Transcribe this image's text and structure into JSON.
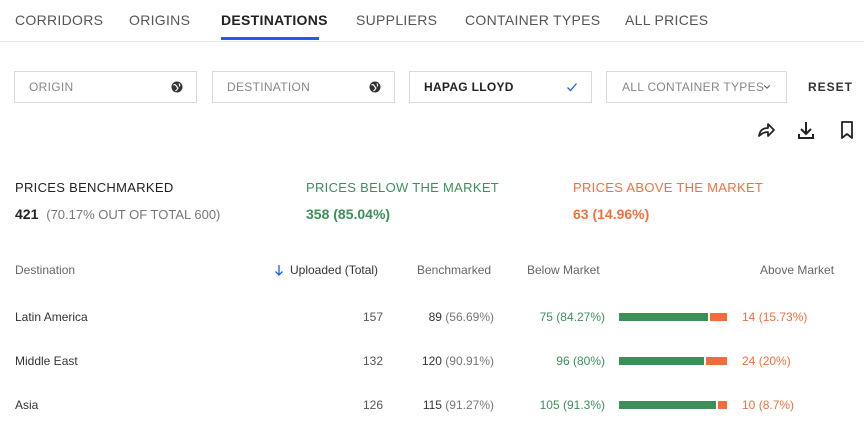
{
  "tabs": [
    "CORRIDORS",
    "ORIGINS",
    "DESTINATIONS",
    "SUPPLIERS",
    "CONTAINER TYPES",
    "ALL PRICES"
  ],
  "active_tab": "DESTINATIONS",
  "filters": {
    "origin_placeholder": "ORIGIN",
    "destination_placeholder": "DESTINATION",
    "supplier_value": "HAPAG LLOYD",
    "container_value": "ALL CONTAINER TYPES",
    "reset_label": "RESET"
  },
  "summary": {
    "benchmarked_label": "PRICES BENCHMARKED",
    "benchmarked_count": "421",
    "benchmarked_note": "(70.17% OUT OF TOTAL 600)",
    "below_label": "PRICES BELOW THE MARKET",
    "below_value": "358  (85.04%)",
    "above_label": "PRICES ABOVE THE MARKET",
    "above_value": "63  (14.96%)"
  },
  "table": {
    "headers": {
      "destination": "Destination",
      "uploaded": "Uploaded (Total)",
      "benchmarked": "Benchmarked",
      "below": "Below Market",
      "above": "Above Market"
    },
    "rows": [
      {
        "destination": "Latin America",
        "uploaded": "157",
        "benchmarked": "89",
        "benchmarked_pct": "(56.69%)",
        "below": "75",
        "below_pct": "(84.27%)",
        "above": "14",
        "above_pct": "(15.73%)",
        "below_fraction": 0.8427
      },
      {
        "destination": "Middle East",
        "uploaded": "132",
        "benchmarked": "120",
        "benchmarked_pct": "(90.91%)",
        "below": "96",
        "below_pct": "(80%)",
        "above": "24",
        "above_pct": "(20%)",
        "below_fraction": 0.8
      },
      {
        "destination": "Asia",
        "uploaded": "126",
        "benchmarked": "115",
        "benchmarked_pct": "(91.27%)",
        "below": "105",
        "below_pct": "(91.3%)",
        "above": "10",
        "above_pct": "(8.7%)",
        "below_fraction": 0.913
      }
    ]
  },
  "colors": {
    "accent": "#1e5ee6",
    "below": "#3d8f5a",
    "above": "#f07040"
  },
  "icons": [
    "globe-icon",
    "check-icon",
    "chevron-down-icon",
    "share-icon",
    "download-icon",
    "bookmark-icon",
    "sort-arrow-icon"
  ]
}
